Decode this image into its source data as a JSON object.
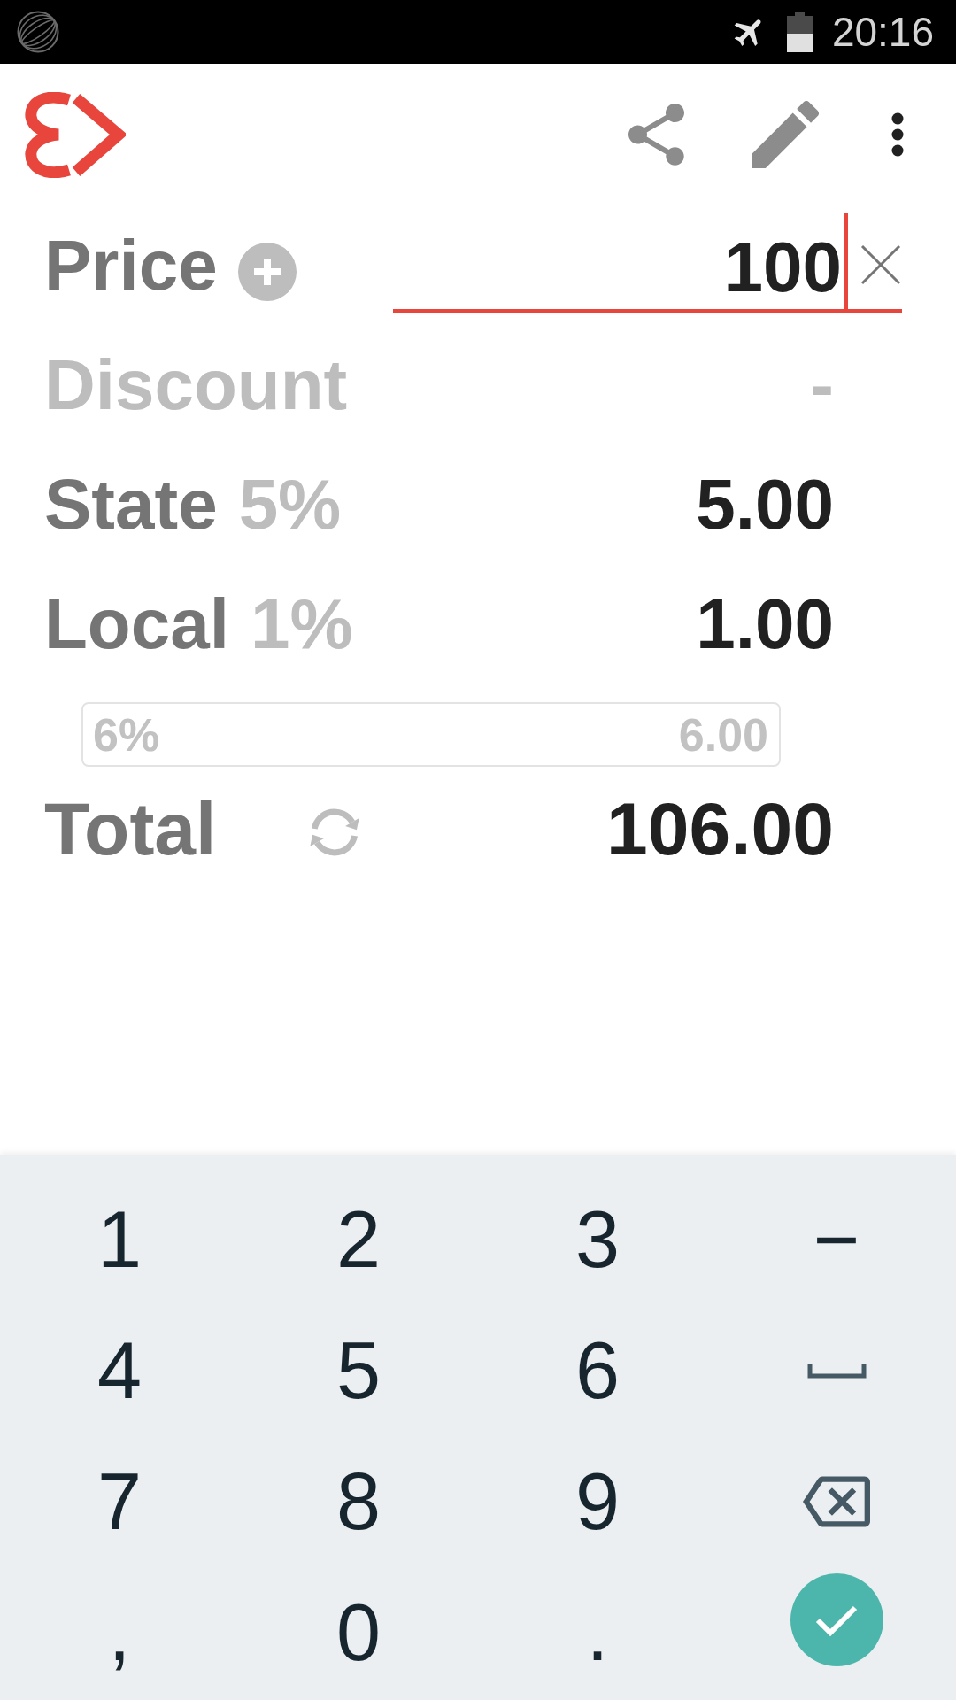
{
  "status_bar": {
    "time": "20:16"
  },
  "price": {
    "label": "Price",
    "value": "100",
    "focused": true
  },
  "discount": {
    "label": "Discount",
    "value": "-",
    "disabled": true
  },
  "taxes": [
    {
      "label": "State",
      "rate": "5%",
      "value": "5.00"
    },
    {
      "label": "Local",
      "rate": "1%",
      "value": "1.00"
    }
  ],
  "tax_summary": {
    "rate": "6%",
    "value": "6.00"
  },
  "total": {
    "label": "Total",
    "value": "106.00"
  },
  "keypad": {
    "keys": [
      {
        "kind": "char",
        "label": "1"
      },
      {
        "kind": "char",
        "label": "2"
      },
      {
        "kind": "char",
        "label": "3"
      },
      {
        "kind": "char",
        "label": "−"
      },
      {
        "kind": "char",
        "label": "4"
      },
      {
        "kind": "char",
        "label": "5"
      },
      {
        "kind": "char",
        "label": "6"
      },
      {
        "kind": "space"
      },
      {
        "kind": "char",
        "label": "7"
      },
      {
        "kind": "char",
        "label": "8"
      },
      {
        "kind": "char",
        "label": "9"
      },
      {
        "kind": "backspace"
      },
      {
        "kind": "char",
        "label": ","
      },
      {
        "kind": "char",
        "label": "0"
      },
      {
        "kind": "char",
        "label": "."
      },
      {
        "kind": "done"
      }
    ]
  }
}
